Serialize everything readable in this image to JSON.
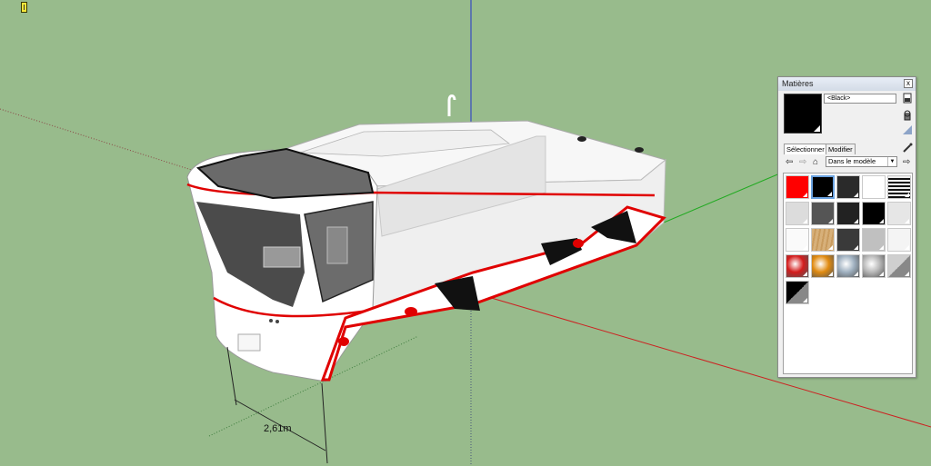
{
  "viewport": {
    "dimension_label": "2,61m"
  },
  "materials_panel": {
    "title": "Matières",
    "close_label": "x",
    "material_name": "<Black>",
    "tabs": [
      "Sélectionner",
      "Modifier"
    ],
    "collection": "Dans le modèle",
    "swatches": [
      {
        "name": "red",
        "color": "#ff0000"
      },
      {
        "name": "black-selected",
        "color": "#000000"
      },
      {
        "name": "dark-gray-1",
        "color": "#2a2a2a"
      },
      {
        "name": "white-1",
        "color": "#ffffff"
      },
      {
        "name": "striped",
        "color": "#333333"
      },
      {
        "name": "light-gray-1",
        "color": "#dcdcdc"
      },
      {
        "name": "gray-1",
        "color": "#555555"
      },
      {
        "name": "dark-gray-2",
        "color": "#222222"
      },
      {
        "name": "black-2",
        "color": "#000000"
      },
      {
        "name": "light-gray-2",
        "color": "#e6e6e6"
      },
      {
        "name": "white-2",
        "color": "#fafafa"
      },
      {
        "name": "wood",
        "color": "#d9b57c"
      },
      {
        "name": "dark-gray-3",
        "color": "#3a3a3a"
      },
      {
        "name": "silver",
        "color": "#c0c0c0"
      },
      {
        "name": "white-3",
        "color": "#f4f4f4"
      },
      {
        "name": "red-glass",
        "color": "#d41c1c"
      },
      {
        "name": "orange-glass",
        "color": "#e08a10"
      },
      {
        "name": "clear-glass",
        "color": "#9fb0c0"
      },
      {
        "name": "metal",
        "color": "#b8b8b8"
      },
      {
        "name": "diagonal-gray",
        "color": "#cfcfcf"
      },
      {
        "name": "black-diagonal",
        "color": "#000000"
      }
    ]
  }
}
